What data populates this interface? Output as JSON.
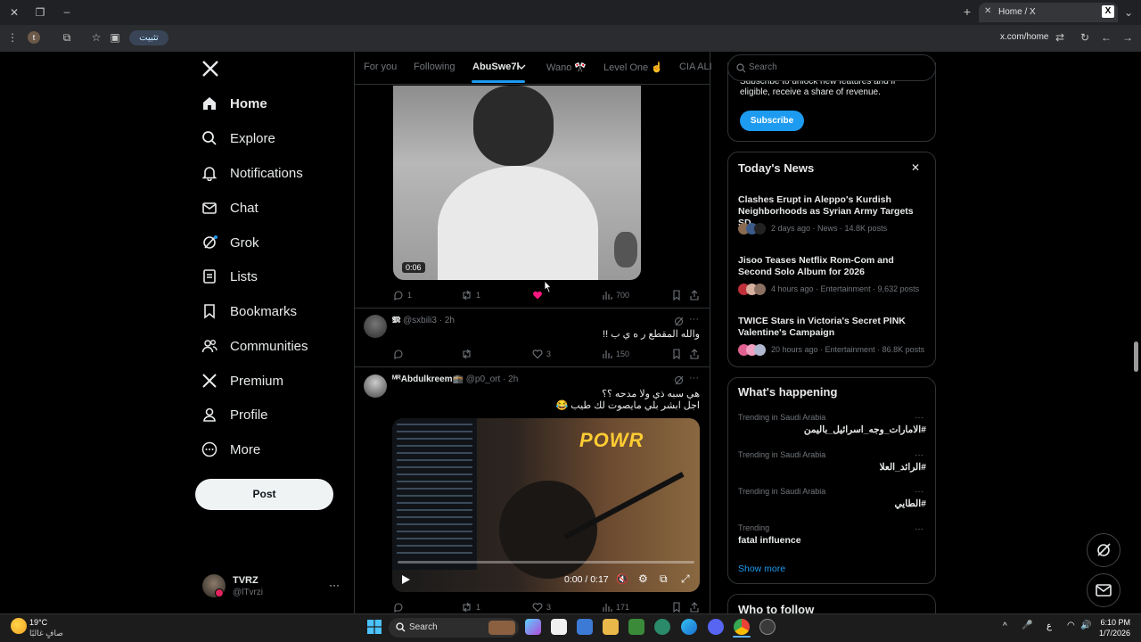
{
  "browser": {
    "tab_title": "Home / X",
    "url": "x.com/home",
    "install_label": "تثبيت",
    "profile_initial": "t"
  },
  "nav": {
    "items": [
      {
        "label": "Home",
        "icon": "home-icon"
      },
      {
        "label": "Explore",
        "icon": "search-icon"
      },
      {
        "label": "Notifications",
        "icon": "bell-icon"
      },
      {
        "label": "Chat",
        "icon": "mail-icon"
      },
      {
        "label": "Grok",
        "icon": "grok-icon"
      },
      {
        "label": "Lists",
        "icon": "list-icon"
      },
      {
        "label": "Bookmarks",
        "icon": "bookmark-icon"
      },
      {
        "label": "Communities",
        "icon": "people-icon"
      },
      {
        "label": "Premium",
        "icon": "x-logo-icon"
      },
      {
        "label": "Profile",
        "icon": "person-icon"
      },
      {
        "label": "More",
        "icon": "more-circle-icon"
      }
    ],
    "post_label": "Post",
    "account_name": "TVRZ",
    "account_handle": "@lTvrzi",
    "account_more": "···"
  },
  "feed": {
    "tabs": [
      "For you",
      "Following",
      "AbuSwe7l",
      "Wano 🎌",
      "Level One ☝",
      "CIA ALI"
    ],
    "active_tab": "AbuSwe7l",
    "post1": {
      "video_time": "0:06",
      "replies": "1",
      "reposts": "1",
      "views": "700"
    },
    "post2": {
      "name": "𝕸",
      "handle": "@sxbili3",
      "time": "· 2h",
      "text": "والله المقطع ر ه ي ب !!",
      "likes": "3",
      "views": "150"
    },
    "post3": {
      "name": "ᴹᴿAbdulkreem🕋",
      "handle": "@p0_ort",
      "time": "· 2h",
      "line1": "هي سبه ذي ولا مدحه ؟؟",
      "line2": "اجل ابشر بلي  مايصوت لك طيب 😂",
      "video_sign": "POWR",
      "player_time": "0:00 / 0:17",
      "reposts": "1",
      "likes": "3",
      "views": "171"
    }
  },
  "right": {
    "search_placeholder": "Search",
    "premium_text_1": "Subscribe to unlock new features and if",
    "premium_text_2": "eligible, receive a share of revenue.",
    "subscribe_label": "Subscribe",
    "news_heading": "Today's News",
    "news": [
      {
        "title": "Clashes Erupt in Aleppo's Kurdish Neighborhoods as Syrian Army Targets SD…",
        "meta": "2 days ago · News · 14.8K posts"
      },
      {
        "title": "Jisoo Teases Netflix Rom-Com and Second Solo Album for 2026",
        "meta": "4 hours ago · Entertainment · 9,632 posts"
      },
      {
        "title": "TWICE Stars in Victoria's Secret PINK Valentine's Campaign",
        "meta": "20 hours ago · Entertainment · 86.8K posts"
      }
    ],
    "happening_heading": "What's happening",
    "trends": [
      {
        "cat": "Trending in Saudi Arabia",
        "name": "#الامارات_وجه_اسرائيل_باليمن"
      },
      {
        "cat": "Trending in Saudi Arabia",
        "name": "#الرائد_العلا"
      },
      {
        "cat": "Trending in Saudi Arabia",
        "name": "#الطايي"
      },
      {
        "cat": "Trending",
        "name": "fatal influence"
      }
    ],
    "show_more": "Show more",
    "who_to_follow": "Who to follow"
  },
  "taskbar": {
    "temp": "19°C",
    "weather": "صافٍ غالبًا",
    "search": "Search",
    "time": "6:10 PM",
    "date": "1/7/2026",
    "lang": "ع"
  },
  "colors": {
    "accent": "#1d9bf0",
    "bg": "#000000",
    "border": "#2f3336",
    "muted": "#71767b"
  }
}
